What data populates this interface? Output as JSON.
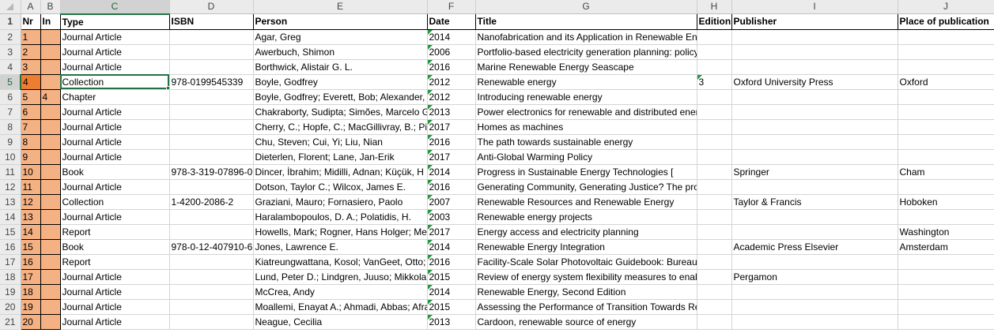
{
  "columns": [
    "A",
    "B",
    "C",
    "D",
    "E",
    "F",
    "G",
    "H",
    "I",
    "J"
  ],
  "selected_column": "C",
  "header_row": {
    "row_number": "1",
    "nr": "Nr",
    "in": "In",
    "type": "Type",
    "isbn": "ISBN",
    "person": "Person",
    "date": "Date",
    "title": "Title",
    "edition": "Edition",
    "publisher": "Publisher",
    "place": "Place of publication"
  },
  "rows": [
    {
      "row": "2",
      "nr": "1",
      "in": "",
      "type": "Journal Article",
      "isbn": "",
      "person": "Agar, Greg",
      "date": "2014",
      "title": "Nanofabrication and its Application in Renewable Energy",
      "edition": "",
      "publisher": "",
      "place": ""
    },
    {
      "row": "3",
      "nr": "2",
      "in": "",
      "type": "Journal Article",
      "isbn": "",
      "person": "Awerbuch, Shimon",
      "date": "2006",
      "title": "Portfolio-based electricity generation planning: policy",
      "edition": "",
      "publisher": "",
      "place": ""
    },
    {
      "row": "4",
      "nr": "3",
      "in": "",
      "type": "Journal Article",
      "isbn": "",
      "person": "Borthwick, Alistair G. L.",
      "date": "2016",
      "title": "Marine Renewable Energy Seascape",
      "edition": "",
      "publisher": "",
      "place": ""
    },
    {
      "row": "5",
      "nr": "4",
      "in": "",
      "type": "Collection",
      "isbn": "978-0199545339",
      "person": "Boyle, Godfrey",
      "date": "2012",
      "title": "Renewable energy",
      "edition": "3",
      "publisher": "Oxford University Press",
      "place": "Oxford"
    },
    {
      "row": "6",
      "nr": "5",
      "in": "4",
      "type": "Chapter",
      "isbn": "",
      "person": "Boyle, Godfrey; Everett, Bob; Alexander, G",
      "date": "2012",
      "title": "Introducing renewable energy",
      "edition": "",
      "publisher": "",
      "place": ""
    },
    {
      "row": "7",
      "nr": "6",
      "in": "",
      "type": "Journal Article",
      "isbn": "",
      "person": "Chakraborty, Sudipta; Simões, Marcelo G.",
      "date": "2013",
      "title": "Power electronics for renewable and distributed energy",
      "edition": "",
      "publisher": "",
      "place": ""
    },
    {
      "row": "8",
      "nr": "7",
      "in": "",
      "type": "Journal Article",
      "isbn": "",
      "person": "Cherry, C.; Hopfe, C.; MacGillivray, B.; Pid",
      "date": "2017",
      "title": "Homes as machines",
      "edition": "",
      "publisher": "",
      "place": ""
    },
    {
      "row": "9",
      "nr": "8",
      "in": "",
      "type": "Journal Article",
      "isbn": "",
      "person": "Chu, Steven; Cui, Yi; Liu, Nian",
      "date": "2016",
      "title": "The path towards sustainable energy",
      "edition": "",
      "publisher": "",
      "place": ""
    },
    {
      "row": "10",
      "nr": "9",
      "in": "",
      "type": "Journal Article",
      "isbn": "",
      "person": "Dieterlen, Florent; Lane, Jan-Erik",
      "date": "2017",
      "title": "Anti-Global Warming Policy",
      "edition": "",
      "publisher": "",
      "place": ""
    },
    {
      "row": "11",
      "nr": "10",
      "in": "",
      "type": "Book",
      "isbn": "978-3-319-07896-0",
      "person": "Dincer, İbrahim; Midilli, Adnan; Küçük, H",
      "date": "2014",
      "title": "Progress in Sustainable Energy Technologies [",
      "edition": "",
      "publisher": "Springer",
      "place": "Cham"
    },
    {
      "row": "12",
      "nr": "11",
      "in": "",
      "type": "Journal Article",
      "isbn": "",
      "person": "Dotson, Taylor C.; Wilcox, James E.",
      "date": "2016",
      "title": "Generating Community, Generating Justice? The pro",
      "edition": "",
      "publisher": "",
      "place": ""
    },
    {
      "row": "13",
      "nr": "12",
      "in": "",
      "type": "Collection",
      "isbn": "1-4200-2086-2",
      "person": "Graziani, Mauro; Fornasiero, Paolo",
      "date": "2007",
      "title": "Renewable Resources and Renewable Energy",
      "edition": "",
      "publisher": "Taylor & Francis",
      "place": "Hoboken"
    },
    {
      "row": "14",
      "nr": "13",
      "in": "",
      "type": "Journal Article",
      "isbn": "",
      "person": "Haralambopoulos, D. A.; Polatidis, H.",
      "date": "2003",
      "title": "Renewable energy projects",
      "edition": "",
      "publisher": "",
      "place": ""
    },
    {
      "row": "15",
      "nr": "14",
      "in": "",
      "type": "Report",
      "isbn": "",
      "person": "Howells, Mark; Rogner, Hans Holger; Mer",
      "date": "2017",
      "title": "Energy access and electricity planning",
      "edition": "",
      "publisher": "",
      "place": "Washington"
    },
    {
      "row": "16",
      "nr": "15",
      "in": "",
      "type": "Book",
      "isbn": "978-0-12-407910-6",
      "person": "Jones, Lawrence E.",
      "date": "2014",
      "title": "Renewable Energy Integration",
      "edition": "",
      "publisher": "Academic Press Elsevier",
      "place": "Amsterdam"
    },
    {
      "row": "17",
      "nr": "16",
      "in": "",
      "type": "Report",
      "isbn": "",
      "person": "Kiatreungwattana, Kosol; VanGeet, Otto; S",
      "date": "2016",
      "title": "Facility-Scale Solar Photovoltaic Guidebook: Bureau o",
      "edition": "",
      "publisher": "",
      "place": ""
    },
    {
      "row": "18",
      "nr": "17",
      "in": "",
      "type": "Journal Article",
      "isbn": "",
      "person": "Lund, Peter D.; Lindgren, Juuso; Mikkola,",
      "date": "2015",
      "title": "Review of energy system flexibility measures to enab",
      "edition": "",
      "publisher": "Pergamon",
      "place": ""
    },
    {
      "row": "19",
      "nr": "18",
      "in": "",
      "type": "Journal Article",
      "isbn": "",
      "person": "McCrea, Andy",
      "date": "2014",
      "title": "Renewable Energy, Second Edition",
      "edition": "",
      "publisher": "",
      "place": ""
    },
    {
      "row": "20",
      "nr": "19",
      "in": "",
      "type": "Journal Article",
      "isbn": "",
      "person": "Moallemi, Enayat A.; Ahmadi, Abbas; Afra",
      "date": "2015",
      "title": "Assessing the Performance of Transition Towards Re",
      "edition": "",
      "publisher": "",
      "place": ""
    },
    {
      "row": "21",
      "nr": "20",
      "in": "",
      "type": "Journal Article",
      "isbn": "",
      "person": "Neague, Cecilia",
      "date": "2013",
      "title": "Cardoon, renewable source of energy",
      "edition": "",
      "publisher": "",
      "place": ""
    }
  ],
  "selected_row": "5",
  "colors": {
    "nr_fill": "#f4b183",
    "nr_active_fill": "#ed7d31",
    "selection_green": "#217346",
    "comment_flag": "#1f9a3d"
  }
}
